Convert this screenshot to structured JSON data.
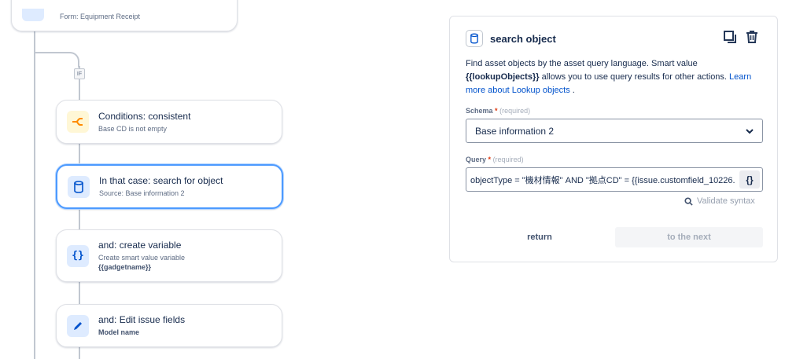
{
  "flow": {
    "top_card": {
      "subtitle": "Form: Equipment Receipt"
    },
    "if_label": "IF",
    "cards": [
      {
        "title": "Conditions: consistent",
        "subtitle": "Base CD is not empty",
        "icon": "branch-icon",
        "icon_color": "#ff8b00",
        "icon_bg": "#fff7d6"
      },
      {
        "title": "In that case: search for object",
        "subtitle": "Source: Base information 2",
        "icon": "database-icon",
        "icon_color": "#0052cc",
        "icon_bg": "#deebff"
      },
      {
        "title": "and: create variable",
        "subtitle": "Create smart value variable",
        "subtitle2": "{{gadgetname}}",
        "icon": "braces-icon",
        "icon_color": "#0052cc",
        "icon_bg": "#deebff"
      },
      {
        "title": "and: Edit issue fields",
        "subtitle": "Model name",
        "icon": "pencil-icon",
        "icon_color": "#0052cc",
        "icon_bg": "#deebff"
      }
    ]
  },
  "panel": {
    "title": "search object",
    "description_part1": "Find asset objects by the asset query language. Smart value ",
    "description_bold": "{{lookupObjects}}",
    "description_part2": " allows you to use query results for other actions. ",
    "description_link": "Learn more about Lookup objects",
    "description_end": " .",
    "schema_label": "Schema",
    "schema_required": "(required)",
    "schema_value": "Base information 2",
    "query_label": "Query",
    "query_required": "(required)",
    "query_value": "objectType = \"機材情報\" AND \"拠点CD\" = {{issue.customfield_10226.",
    "braces_button": "{}",
    "validate_label": "Validate syntax",
    "return_button": "return",
    "next_button": "to the next"
  },
  "colors": {
    "accent": "#0052cc",
    "selected_border": "#4c9aff",
    "required": "#de350b"
  }
}
